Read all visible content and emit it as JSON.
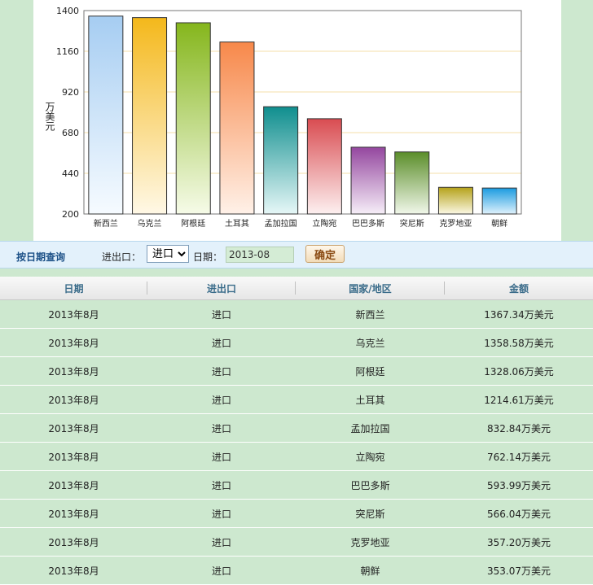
{
  "chart_data": {
    "type": "bar",
    "ylabel": "万美元",
    "ylim": [
      200,
      1400
    ],
    "yticks": [
      200,
      440,
      680,
      920,
      1160,
      1400
    ],
    "grid": true,
    "categories": [
      "新西兰",
      "乌克兰",
      "阿根廷",
      "土耳其",
      "孟加拉国",
      "立陶宛",
      "巴巴多斯",
      "突尼斯",
      "克罗地亚",
      "朝鲜"
    ],
    "values": [
      1367.34,
      1358.58,
      1328.06,
      1214.61,
      832.84,
      762.14,
      593.99,
      566.04,
      357.2,
      353.07
    ],
    "bar_colors": [
      [
        "#a6cdf2",
        "#f6fbff"
      ],
      [
        "#f4b81b",
        "#fff8e6"
      ],
      [
        "#85b61c",
        "#f6fbe8"
      ],
      [
        "#f7884a",
        "#fff1e8"
      ],
      [
        "#0f8e8e",
        "#e6f7f7"
      ],
      [
        "#d94c51",
        "#fdf0f0"
      ],
      [
        "#94479f",
        "#f6eef8"
      ],
      [
        "#5b8e2a",
        "#f1f7ea"
      ],
      [
        "#b5a21a",
        "#fbf8e4"
      ],
      [
        "#1b9be0",
        "#dff2fc"
      ]
    ],
    "grid_color": "#f5dfa8"
  },
  "query": {
    "title": "按日期查询",
    "io_label": "进出口：",
    "io_selected": "进口",
    "date_label": "日期：",
    "date_value": "2013-08",
    "confirm_label": "确定"
  },
  "table": {
    "headers": [
      "日期",
      "进出口",
      "国家/地区",
      "金额"
    ],
    "rows": [
      [
        "2013年8月",
        "进口",
        "新西兰",
        "1367.34万美元"
      ],
      [
        "2013年8月",
        "进口",
        "乌克兰",
        "1358.58万美元"
      ],
      [
        "2013年8月",
        "进口",
        "阿根廷",
        "1328.06万美元"
      ],
      [
        "2013年8月",
        "进口",
        "土耳其",
        "1214.61万美元"
      ],
      [
        "2013年8月",
        "进口",
        "孟加拉国",
        "832.84万美元"
      ],
      [
        "2013年8月",
        "进口",
        "立陶宛",
        "762.14万美元"
      ],
      [
        "2013年8月",
        "进口",
        "巴巴多斯",
        "593.99万美元"
      ],
      [
        "2013年8月",
        "进口",
        "突尼斯",
        "566.04万美元"
      ],
      [
        "2013年8月",
        "进口",
        "克罗地亚",
        "357.20万美元"
      ],
      [
        "2013年8月",
        "进口",
        "朝鲜",
        "353.07万美元"
      ]
    ]
  }
}
